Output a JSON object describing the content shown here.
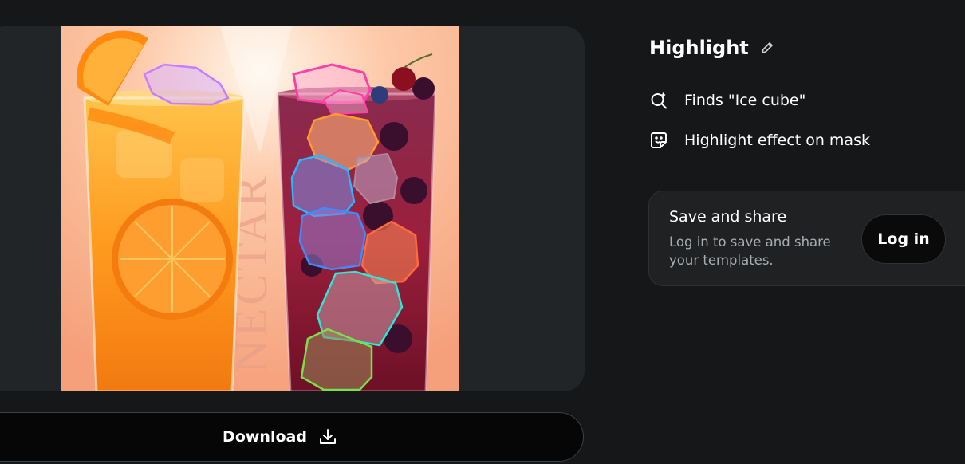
{
  "panel": {
    "title": "Highlight",
    "steps": [
      {
        "label": "Finds \"Ice cube\"",
        "icon": "search-sparkle-icon"
      },
      {
        "label": "Highlight effect on mask",
        "icon": "sticker-icon"
      }
    ]
  },
  "save_card": {
    "title": "Save and share",
    "description": "Log in to save and share your templates.",
    "login_label": "Log in"
  },
  "preview": {
    "download_label": "Download",
    "watermark_text": "NECTAR",
    "mask_colors": [
      "#c77dff",
      "#ff3fa8",
      "#ff9a2e",
      "#2fb4ff",
      "#3b8cff",
      "#ff6a3d",
      "#2ee6d6",
      "#7ae04a"
    ]
  }
}
